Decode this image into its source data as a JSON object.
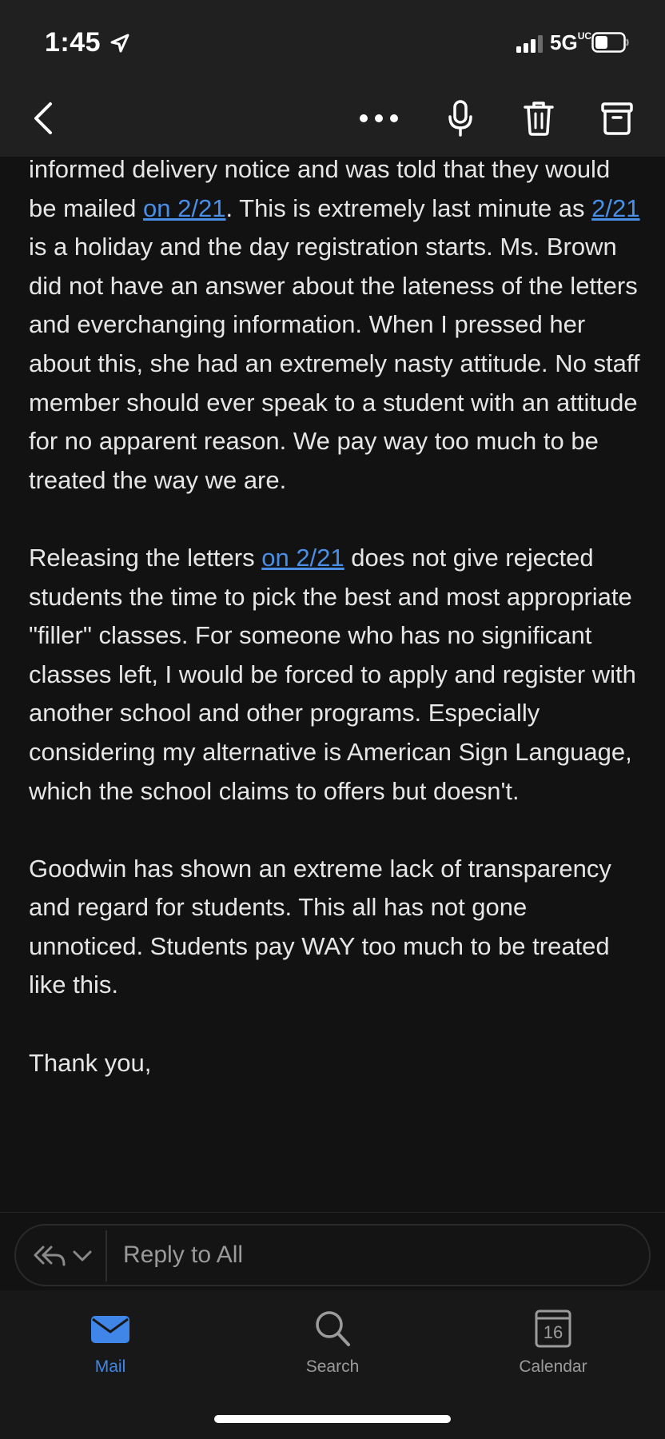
{
  "status_bar": {
    "time": "1:45",
    "network": "5G",
    "network_suffix": "UC"
  },
  "toolbar": {
    "back_icon": "chevron-left-icon",
    "more_icon": "ellipsis-icon",
    "mic_icon": "microphone-icon",
    "trash_icon": "trash-icon",
    "archive_icon": "archive-icon"
  },
  "email": {
    "p1": {
      "a": "informed delivery notice and was told that they would be mailed ",
      "link1": "on 2/21",
      "b": ". This is extremely last minute as ",
      "link2": "2/21",
      "c": " is a holiday and the day registration starts. Ms. Brown did not have an answer about the lateness of the letters and everchanging information. When I pressed her about this, she had an extremely nasty attitude. No staff member should ever speak to a student with an attitude for no apparent reason. We pay way too much to be treated the way we are."
    },
    "p2": {
      "a": "Releasing the letters ",
      "link1": "on 2/21",
      "b": " does not give rejected students the time to pick the best and most appropriate \"filler\" classes. For someone who has no significant classes left, I would be forced to apply and register with another school and other programs. Especially considering my alternative is American Sign Language, which the school claims to offers but doesn't."
    },
    "p3": "Goodwin has shown an extreme lack of transparency and regard for students. This all has not gone unnoticed. Students pay WAY too much to be treated like this.",
    "p4": "Thank you,"
  },
  "reply": {
    "placeholder": "Reply to All",
    "icon": "reply-all-icon"
  },
  "tabs": [
    {
      "label": "Mail",
      "icon": "mail-icon",
      "active": true
    },
    {
      "label": "Search",
      "icon": "search-icon",
      "active": false
    },
    {
      "label": "Calendar",
      "icon": "calendar-icon",
      "day": "16",
      "active": false
    }
  ],
  "colors": {
    "accent": "#3f86e8",
    "link": "#4a8fe7",
    "background": "#121212"
  }
}
